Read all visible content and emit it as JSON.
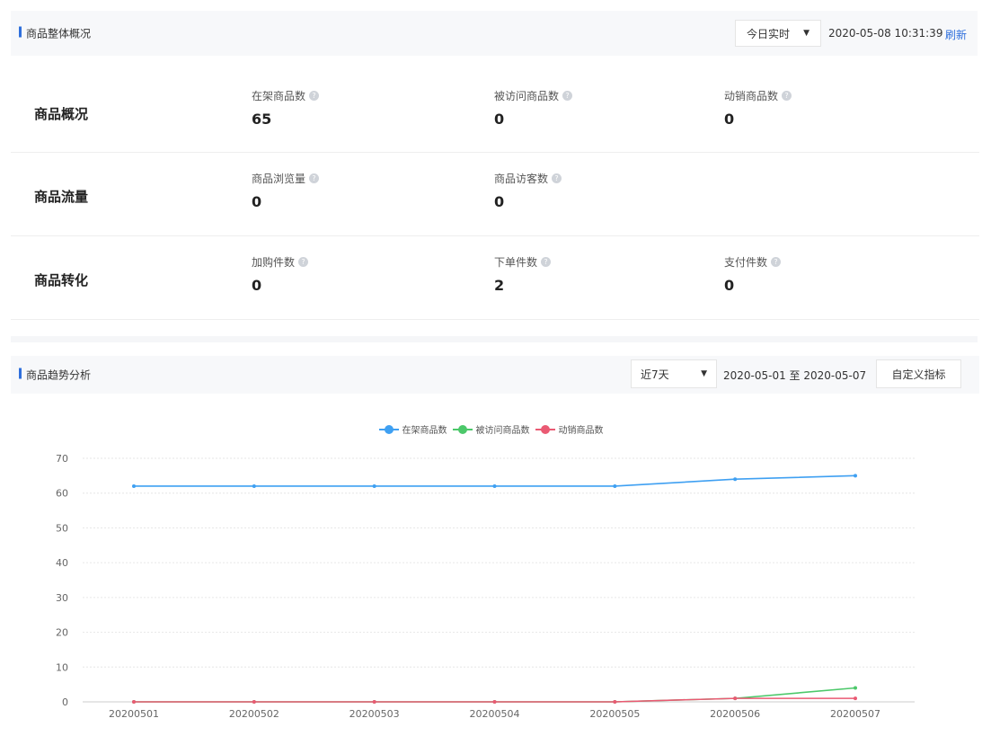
{
  "overview": {
    "title": "商品整体概况",
    "period_select": "今日实时",
    "timestamp": "2020-05-08 10:31:39",
    "refresh": "刷新",
    "rows": [
      {
        "label": "商品概况",
        "metrics": [
          {
            "label": "在架商品数",
            "value": "65"
          },
          {
            "label": "被访问商品数",
            "value": "0"
          },
          {
            "label": "动销商品数",
            "value": "0"
          }
        ]
      },
      {
        "label": "商品流量",
        "metrics": [
          {
            "label": "商品浏览量",
            "value": "0"
          },
          {
            "label": "商品访客数",
            "value": "0"
          }
        ]
      },
      {
        "label": "商品转化",
        "metrics": [
          {
            "label": "加购件数",
            "value": "0"
          },
          {
            "label": "下单件数",
            "value": "2"
          },
          {
            "label": "支付件数",
            "value": "0"
          }
        ]
      }
    ]
  },
  "trend": {
    "title": "商品趋势分析",
    "period_select": "近7天",
    "date_range": "2020-05-01 至 2020-05-07",
    "custom_button": "自定义指标"
  },
  "chart_data": {
    "type": "line",
    "x": [
      "20200501",
      "20200502",
      "20200503",
      "20200504",
      "20200505",
      "20200506",
      "20200507"
    ],
    "series": [
      {
        "name": "在架商品数",
        "color": "#3fa0f2",
        "values": [
          62,
          62,
          62,
          62,
          62,
          64,
          65
        ]
      },
      {
        "name": "被访问商品数",
        "color": "#4cc86a",
        "values": [
          0,
          0,
          0,
          0,
          0,
          1,
          4
        ]
      },
      {
        "name": "动销商品数",
        "color": "#ea5a73",
        "values": [
          0,
          0,
          0,
          0,
          0,
          1,
          1
        ]
      }
    ],
    "ylim": [
      0,
      70
    ],
    "yticks": [
      0,
      10,
      20,
      30,
      40,
      50,
      60,
      70
    ],
    "grid": true,
    "legend_position": "top-center"
  }
}
